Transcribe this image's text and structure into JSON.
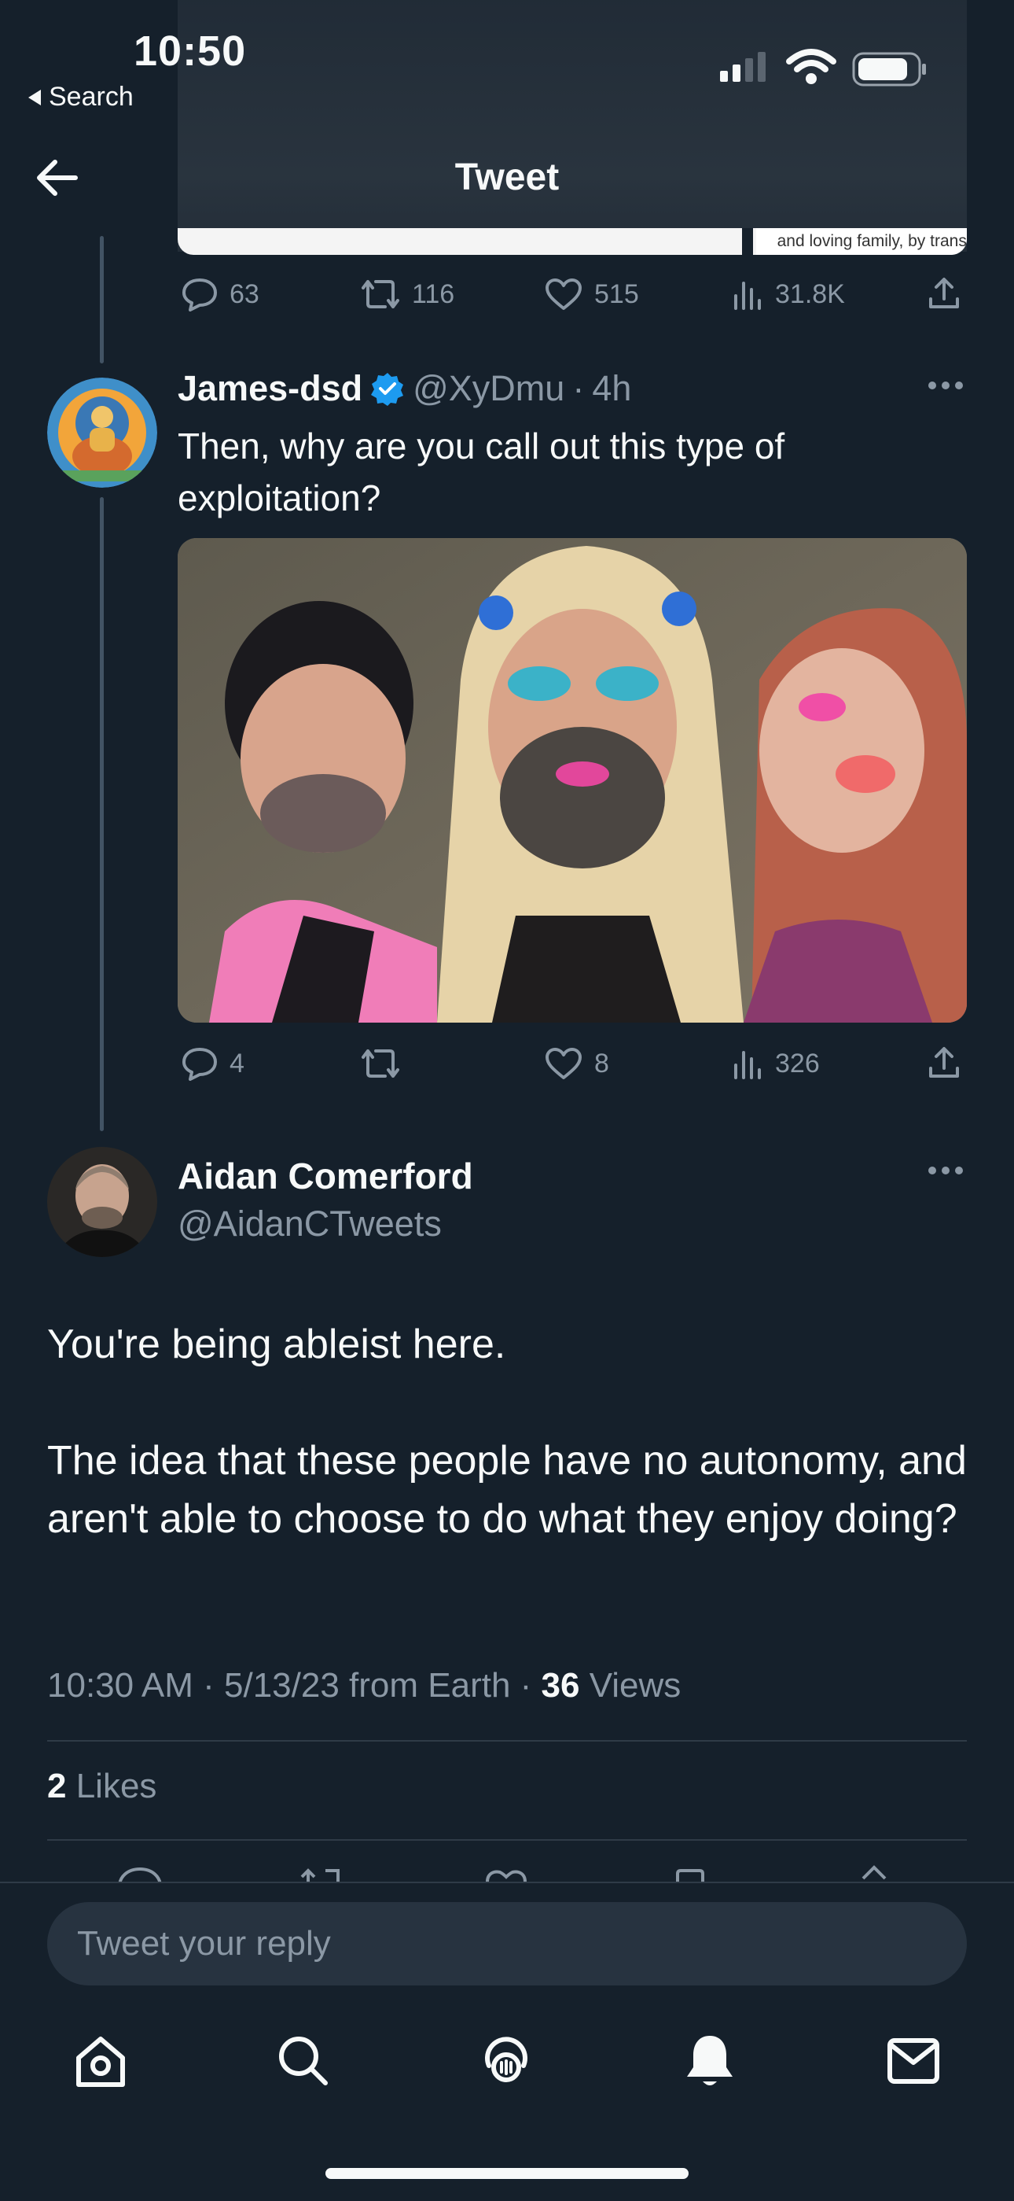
{
  "status_bar": {
    "time": "10:50",
    "back_label": "Search"
  },
  "header": {
    "title": "Tweet"
  },
  "prev_tweet": {
    "card_caption": "and loving family, by transforming care systems",
    "actions": {
      "replies": "63",
      "retweets": "116",
      "likes": "515",
      "views": "31.8K"
    }
  },
  "reply_tweet": {
    "name": "James-dsd",
    "handle": "@XyDmu",
    "time": "4h",
    "text_line1": "Then, why are you call out this type of",
    "text_line2": "exploitation?",
    "actions": {
      "replies": "4",
      "retweets": "",
      "likes": "8",
      "views": "326"
    }
  },
  "main_tweet": {
    "name": "Aidan Comerford",
    "handle": "@AidanCTweets",
    "para1": "You're being ableist here.",
    "para2": "The idea that these people have no autonomy, and aren't able to choose to do what they enjoy doing?",
    "timestamp": "10:30 AM · 5/13/23 from Earth · ",
    "views_count": "36",
    "views_label": " Views",
    "likes_count": "2",
    "likes_label": " Likes"
  },
  "reply_bar": {
    "placeholder": "Tweet your reply"
  },
  "colors": {
    "background": "#15202b",
    "muted": "#8b98a5",
    "verified": "#1d9bf0",
    "thread_line": "#425364"
  },
  "icons": [
    "back-arrow-icon",
    "reply-icon",
    "retweet-icon",
    "like-icon",
    "views-icon",
    "share-icon",
    "more-icon",
    "verified-icon",
    "home-icon",
    "search-icon",
    "spaces-icon",
    "notifications-icon",
    "messages-icon"
  ]
}
